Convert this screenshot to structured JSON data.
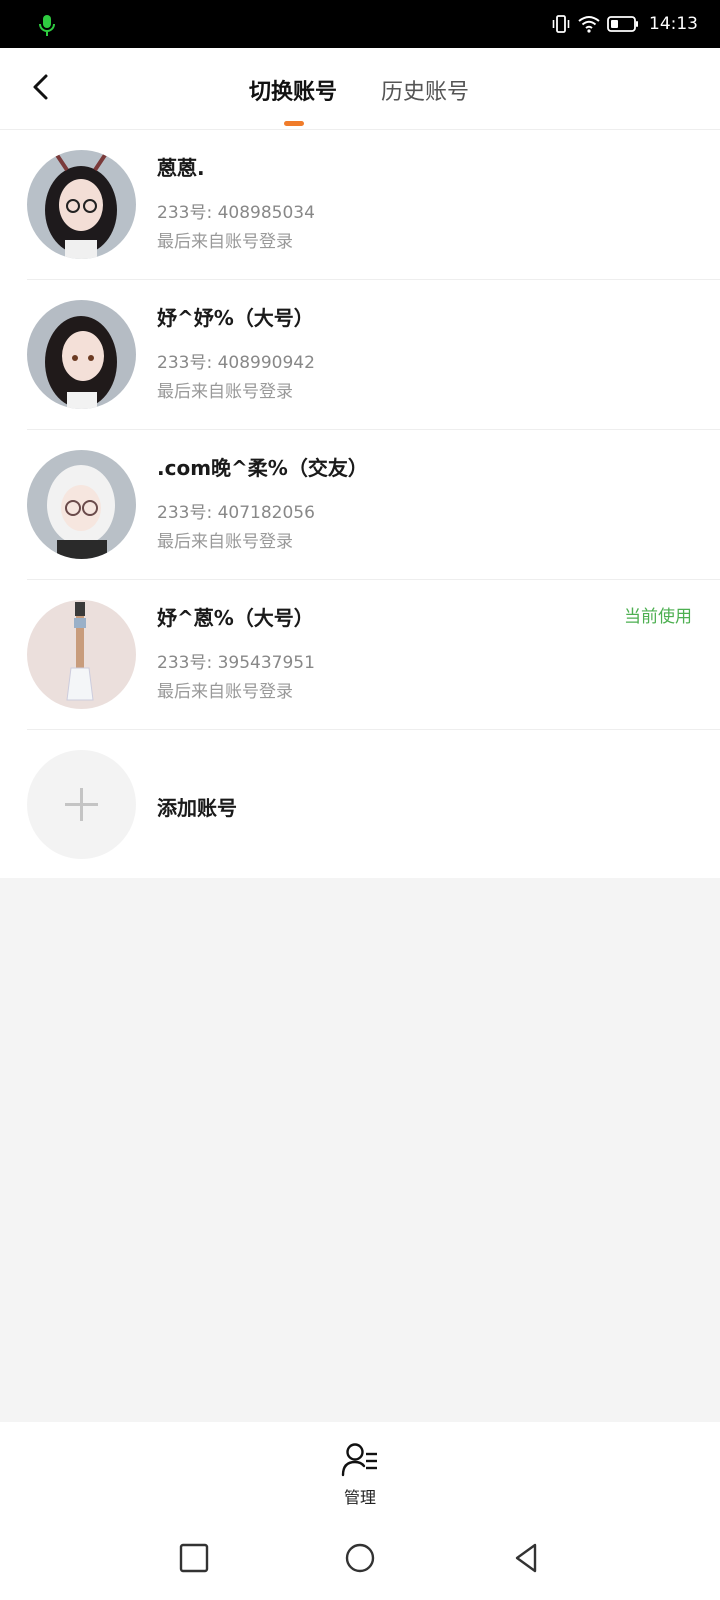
{
  "status_bar": {
    "time": "14:13"
  },
  "header": {
    "back_icon": "chevron-left-icon",
    "tabs": [
      {
        "label": "切换账号",
        "active": true
      },
      {
        "label": "历史账号",
        "active": false
      }
    ],
    "indicator_color": "#f07c2a"
  },
  "accounts": [
    {
      "name": "蒽蒽.",
      "id_line": "233号: 408985034",
      "last_login": "最后来自账号登录",
      "current": ""
    },
    {
      "name": "妤^妤%（大号）",
      "id_line": "233号: 408990942",
      "last_login": "最后来自账号登录",
      "current": ""
    },
    {
      "name": ".com晚^柔%（交友）",
      "id_line": "233号: 407182056",
      "last_login": "最后来自账号登录",
      "current": ""
    },
    {
      "name": "妤^蒽%（大号）",
      "id_line": "233号: 395437951",
      "last_login": "最后来自账号登录",
      "current": "当前使用"
    }
  ],
  "add_account": {
    "label": "添加账号",
    "icon": "plus-icon"
  },
  "bottom": {
    "manage_label": "管理",
    "manage_icon": "user-list-icon"
  },
  "colors": {
    "accent": "#f07c2a",
    "current_badge": "#4caf50"
  }
}
